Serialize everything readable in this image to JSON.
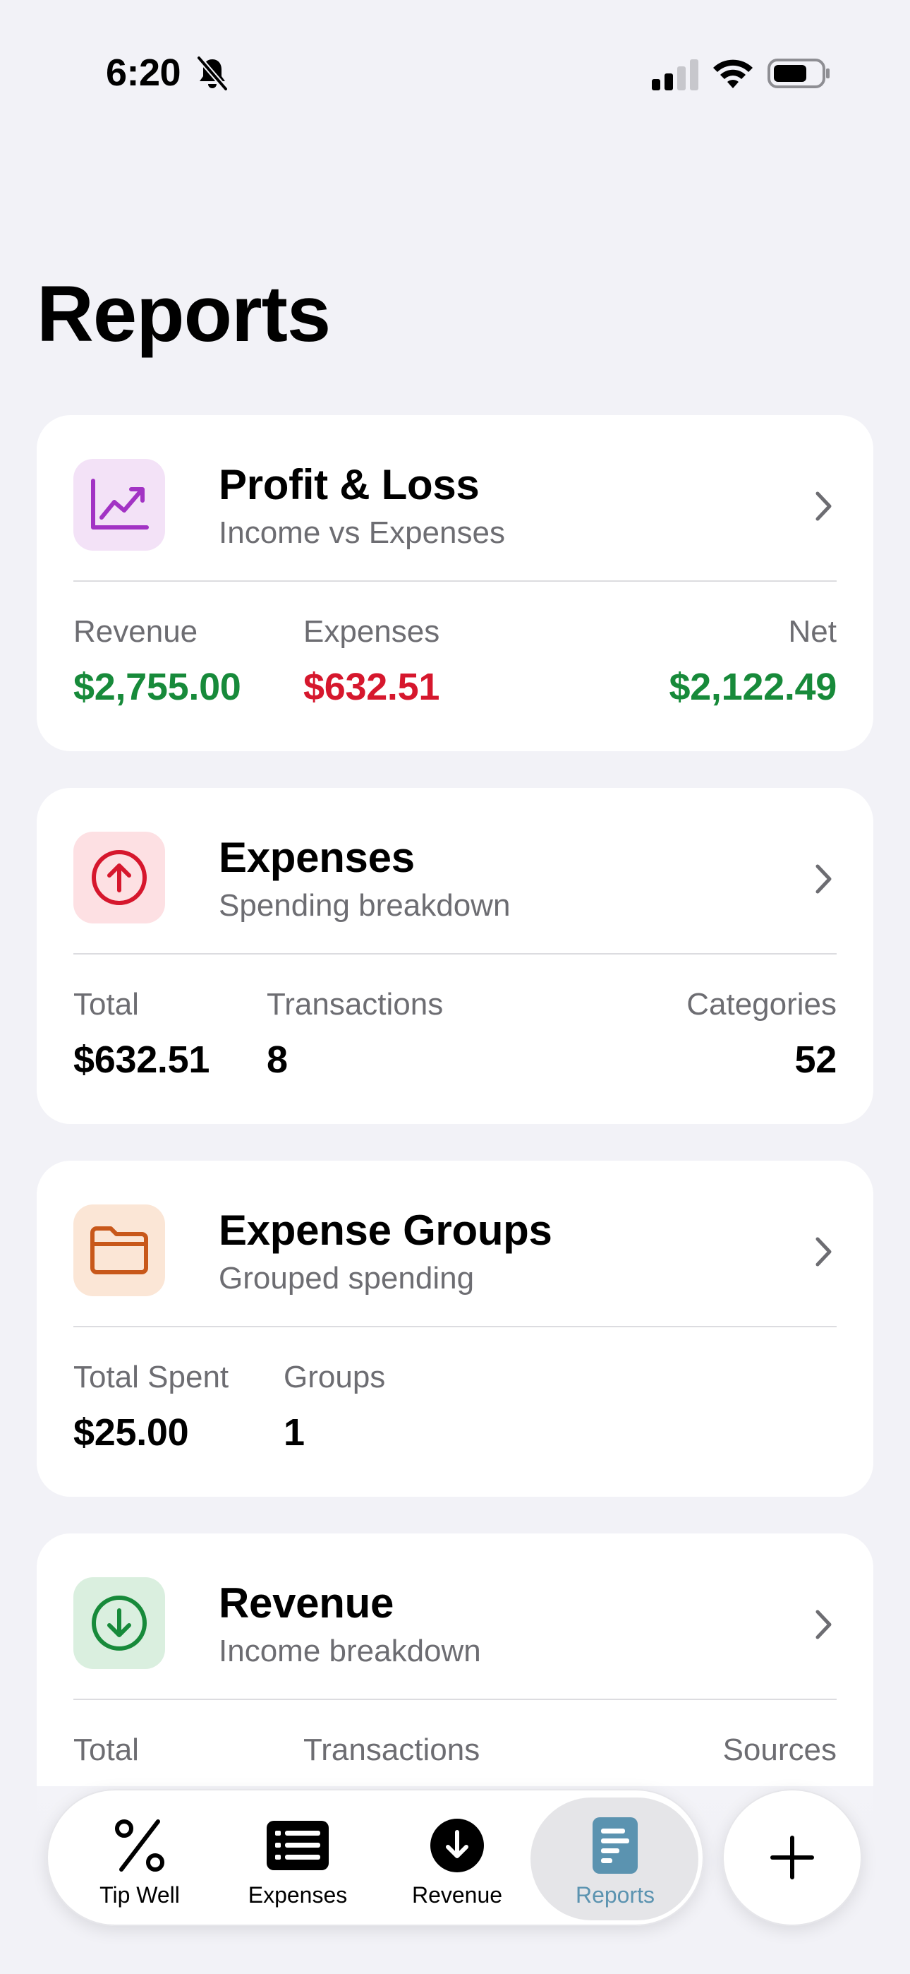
{
  "status_bar": {
    "time": "6:20"
  },
  "page_title": "Reports",
  "cards": {
    "pnl": {
      "title": "Profit & Loss",
      "subtitle": "Income vs Expenses",
      "revenue_label": "Revenue",
      "revenue_value": "$2,755.00",
      "expenses_label": "Expenses",
      "expenses_value": "$632.51",
      "net_label": "Net",
      "net_value": "$2,122.49"
    },
    "expenses": {
      "title": "Expenses",
      "subtitle": "Spending breakdown",
      "total_label": "Total",
      "total_value": "$632.51",
      "transactions_label": "Transactions",
      "transactions_value": "8",
      "categories_label": "Categories",
      "categories_value": "52"
    },
    "groups": {
      "title": "Expense Groups",
      "subtitle": "Grouped spending",
      "spent_label": "Total Spent",
      "spent_value": "$25.00",
      "groups_label": "Groups",
      "groups_value": "1"
    },
    "revenue": {
      "title": "Revenue",
      "subtitle": "Income breakdown",
      "total_label": "Total",
      "transactions_label": "Transactions",
      "sources_label": "Sources"
    }
  },
  "tab_bar": {
    "tabs": [
      {
        "label": "Tip Well",
        "icon": "percent-icon"
      },
      {
        "label": "Expenses",
        "icon": "list-icon"
      },
      {
        "label": "Revenue",
        "icon": "arrow-down-circle-icon"
      },
      {
        "label": "Reports",
        "icon": "document-icon",
        "active": true
      }
    ],
    "plus": "plus-icon"
  },
  "colors": {
    "positive": "#178a3a",
    "negative": "#d6172d",
    "active_tab": "#5b93b0"
  }
}
